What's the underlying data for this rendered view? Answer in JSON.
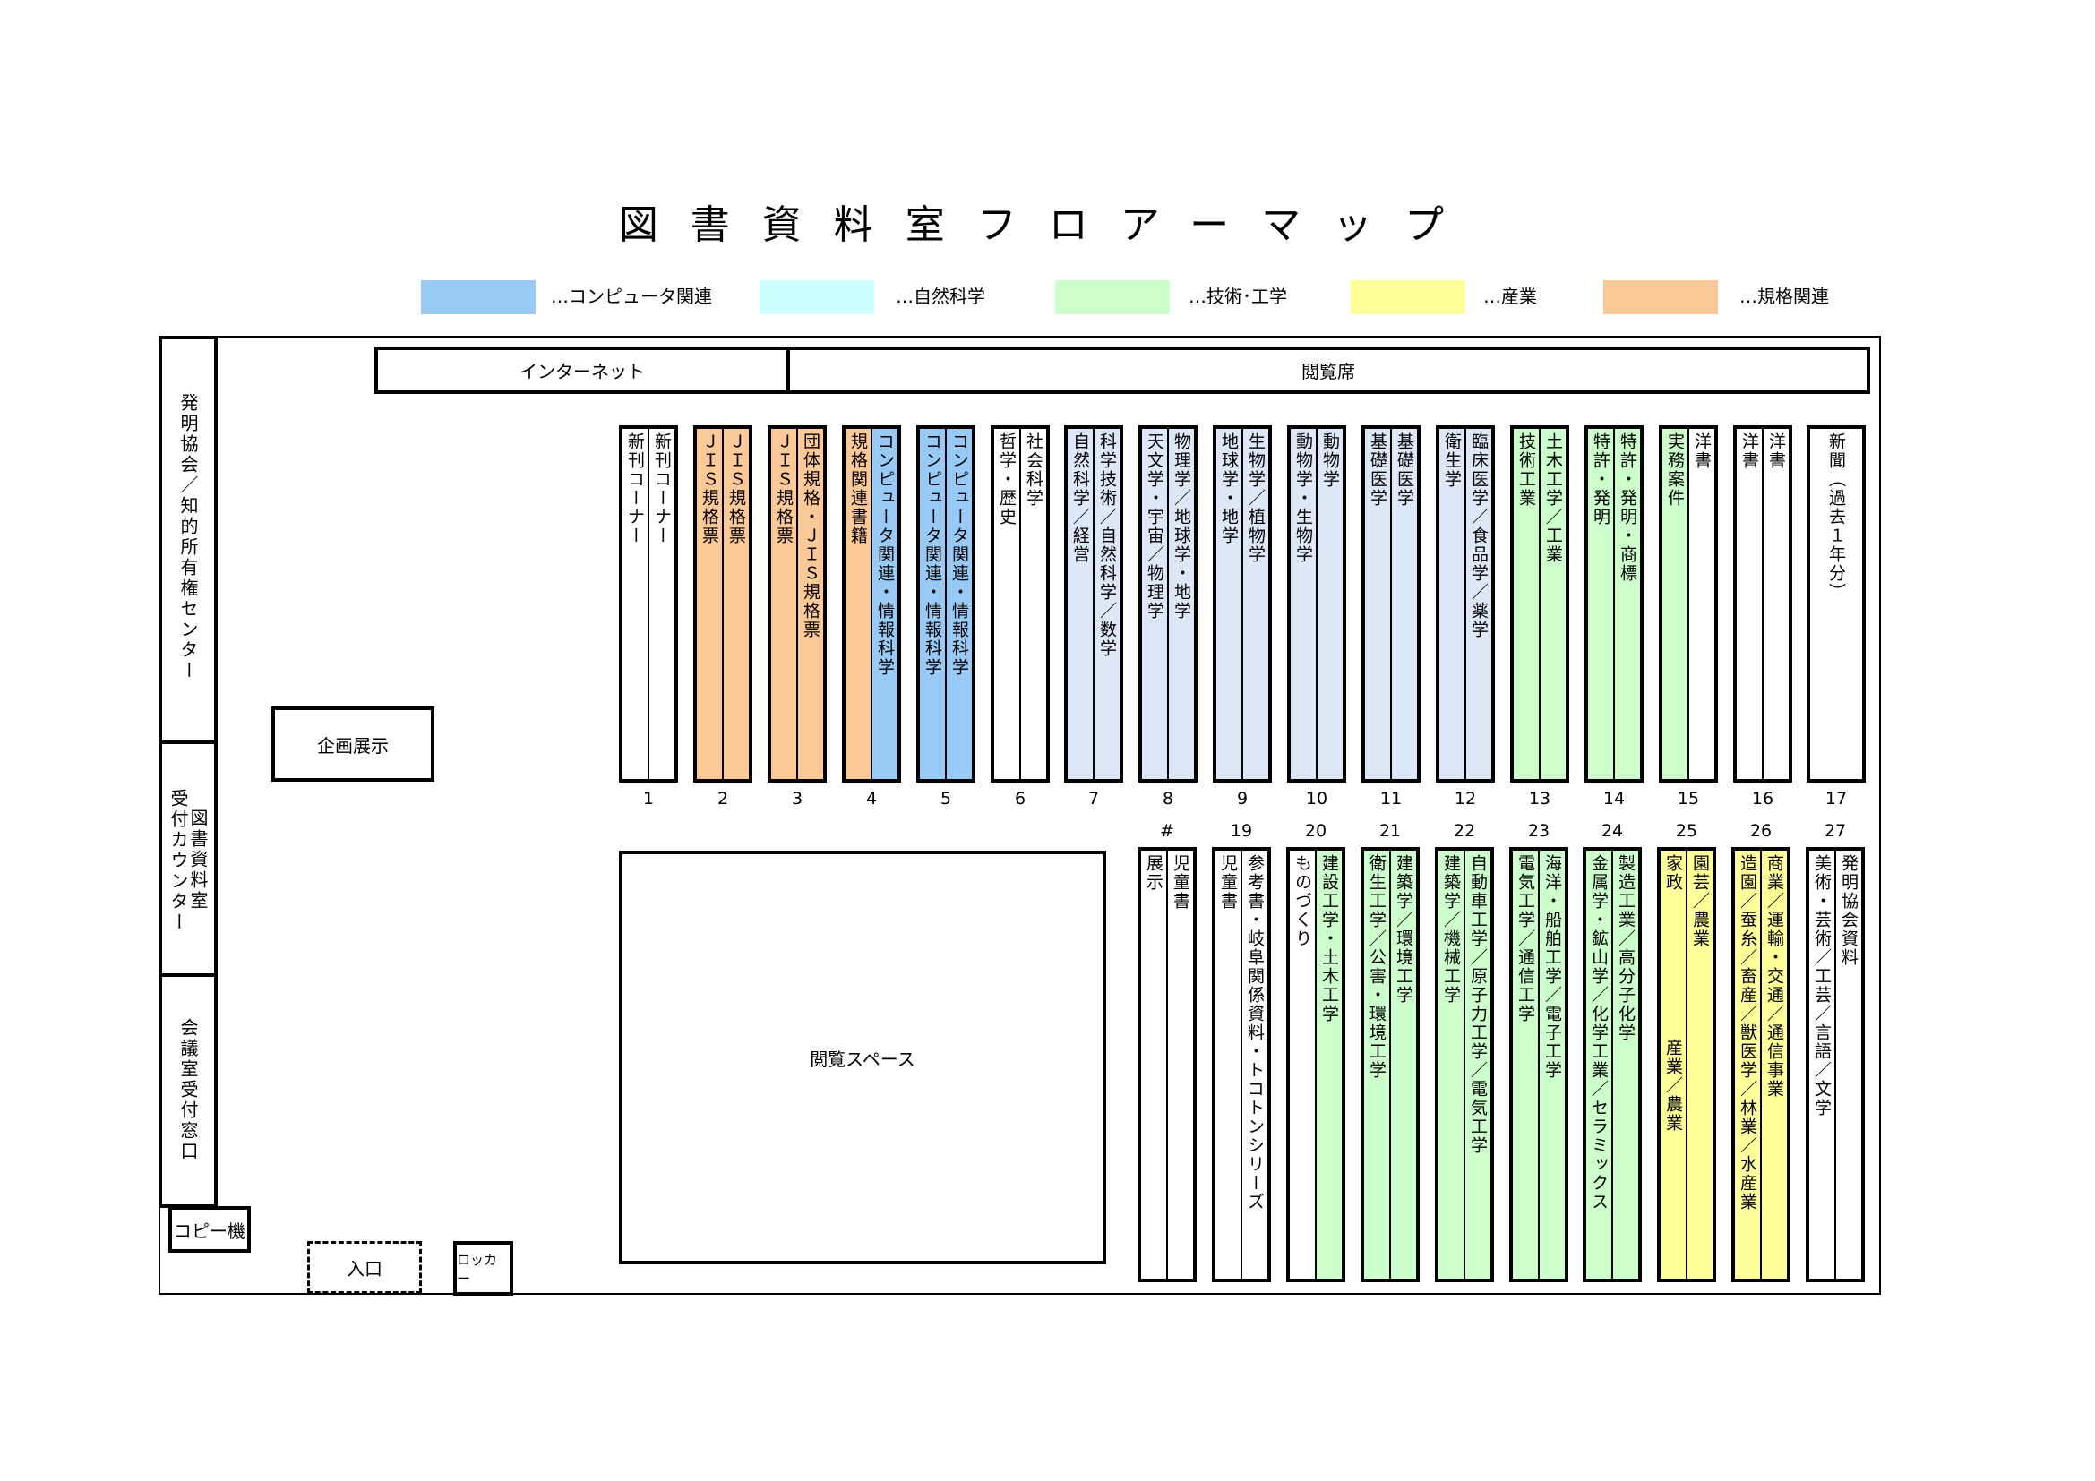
{
  "title": "図書資料室フロアーマップ",
  "legend": [
    {
      "label": "…コンピュータ関連",
      "color": "#99c9f5"
    },
    {
      "label": "…自然科学",
      "color": "#ccffff"
    },
    {
      "label": "…技術･工学",
      "color": "#ccffcc"
    },
    {
      "label": "…産業",
      "color": "#ffff99"
    },
    {
      "label": "…規格関連",
      "color": "#fbc897"
    }
  ],
  "colors": {
    "computer": "#99c9f5",
    "science": "#dce8f7",
    "science_legend": "#ccffff",
    "tech": "#ccffcc",
    "industry": "#ffff99",
    "standards": "#fbc897",
    "none": "#ffffff"
  },
  "rooms": {
    "internet": "インターネット",
    "reading_seats": "閲覧席",
    "hatsumei_center": "発明協会／知的所有権センター",
    "library_counter_1": "図書資料室",
    "library_counter_2": "受付カウンター",
    "meeting_counter": "会議室受付窓口",
    "copy": "コピー機",
    "entrance": "入口",
    "locker": "ロッカー",
    "exhibit": "企画展示",
    "reading_space": "閲覧スペース"
  },
  "top_shelves": [
    {
      "num": "1",
      "color": "none",
      "left": "新刊コーナー",
      "right": "新刊コーナー"
    },
    {
      "num": "2",
      "color": "standards",
      "left": "ＪＩＳ規格票",
      "right": "ＪＩＳ規格票"
    },
    {
      "num": "3",
      "color": "standards",
      "left": "ＪＩＳ規格票",
      "right": "団体規格・ＪＩＳ規格票"
    },
    {
      "num": "4",
      "color": "standards",
      "right_color": "computer",
      "left": "規格関連書籍",
      "right": "コンピュータ関連・情報科学"
    },
    {
      "num": "5",
      "color": "computer",
      "left": "コンピュータ関連・情報科学",
      "right": "コンピュータ関連・情報科学"
    },
    {
      "num": "6",
      "color": "none",
      "left": "哲学・歴史",
      "right": "社会科学"
    },
    {
      "num": "7",
      "color": "science",
      "left": "自然科学／経営",
      "right": "科学技術／自然科学／数学"
    },
    {
      "num": "8",
      "color": "science",
      "left": "天文学・宇宙／物理学",
      "right": "物理学／地球学・地学"
    },
    {
      "num": "9",
      "color": "science",
      "left": "地球学・地学",
      "right": "生物学／植物学"
    },
    {
      "num": "10",
      "color": "science",
      "left": "動物学・生物学",
      "right": "動物学"
    },
    {
      "num": "11",
      "color": "science",
      "left": "基礎医学",
      "right": "基礎医学"
    },
    {
      "num": "12",
      "color": "science",
      "left": "衛生学",
      "right": "臨床医学／食品学／薬学"
    },
    {
      "num": "13",
      "color": "tech",
      "left": "技術工業",
      "right": "土木工学／工業"
    },
    {
      "num": "14",
      "color": "tech",
      "left": "特許・発明",
      "right": "特許・発明・商標"
    },
    {
      "num": "15",
      "color": "tech",
      "right_color": "none",
      "left": "実務案件",
      "right": "洋書"
    },
    {
      "num": "16",
      "color": "none",
      "left": "洋書",
      "right": "洋書"
    },
    {
      "num": "17",
      "color": "none",
      "single": true,
      "left": "新聞（過去１年分）"
    }
  ],
  "bottom_shelves": [
    {
      "num": "#",
      "color": "none",
      "left": "展示",
      "right": "児童書"
    },
    {
      "num": "19",
      "color": "none",
      "left": "児童書",
      "right": "参考書・岐阜関係資料・トコトンシリーズ"
    },
    {
      "num": "20",
      "color": "none",
      "right_color": "tech",
      "left": "ものづくり",
      "right": "建設工学・土木工学"
    },
    {
      "num": "21",
      "color": "tech",
      "left": "衛生工学／公害・環境工学",
      "right": "建築学／環境工学"
    },
    {
      "num": "22",
      "color": "tech",
      "left": "建築学／機械工学",
      "right": "自動車工学／原子力工学／電気工学"
    },
    {
      "num": "23",
      "color": "tech",
      "left": "電気工学／通信工学",
      "right": "海洋・船舶工学／電子工学"
    },
    {
      "num": "24",
      "color": "tech",
      "left": "金属学・鉱山学／化学工業／セラミックス",
      "right": "製造工業／高分子化学"
    },
    {
      "num": "25",
      "color": "industry",
      "left": "家政",
      "left_sub": "産業／農業",
      "right": "園芸／農業"
    },
    {
      "num": "26",
      "color": "industry",
      "left": "造園／蚕糸／畜産／獣医学／林業／水産業",
      "right": "商業／運輸・交通／通信事業"
    },
    {
      "num": "27",
      "color": "none",
      "left": "美術・芸術／工芸／言語／文学",
      "right": "発明協会資料"
    }
  ]
}
